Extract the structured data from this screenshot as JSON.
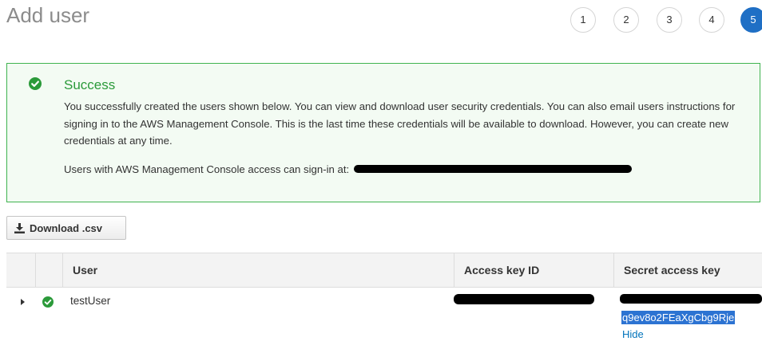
{
  "page": {
    "title": "Add user"
  },
  "steps": [
    {
      "label": "1",
      "active": false
    },
    {
      "label": "2",
      "active": false
    },
    {
      "label": "3",
      "active": false
    },
    {
      "label": "4",
      "active": false
    },
    {
      "label": "5",
      "active": true
    }
  ],
  "alert": {
    "title": "Success",
    "body": "You successfully created the users shown below. You can view and download user security credentials. You can also email users instructions for signing in to the AWS Management Console. This is the last time these credentials will be available to download. However, you can create new credentials at any time.",
    "signin_prefix": "Users with AWS Management Console access can sign-in at:"
  },
  "toolbar": {
    "download_label": "Download .csv"
  },
  "table": {
    "headers": {
      "user": "User",
      "access_key": "Access key ID",
      "secret_key": "Secret access key"
    },
    "rows": [
      {
        "user": "testUser",
        "secret_visible": "q9ev8o2FEaXgCbg9Rje",
        "hide_label": "Hide"
      }
    ]
  },
  "colors": {
    "accent": "#1f6fc5",
    "success": "#2b9a3a",
    "success_border": "#3fb34f",
    "link": "#0073bb"
  }
}
